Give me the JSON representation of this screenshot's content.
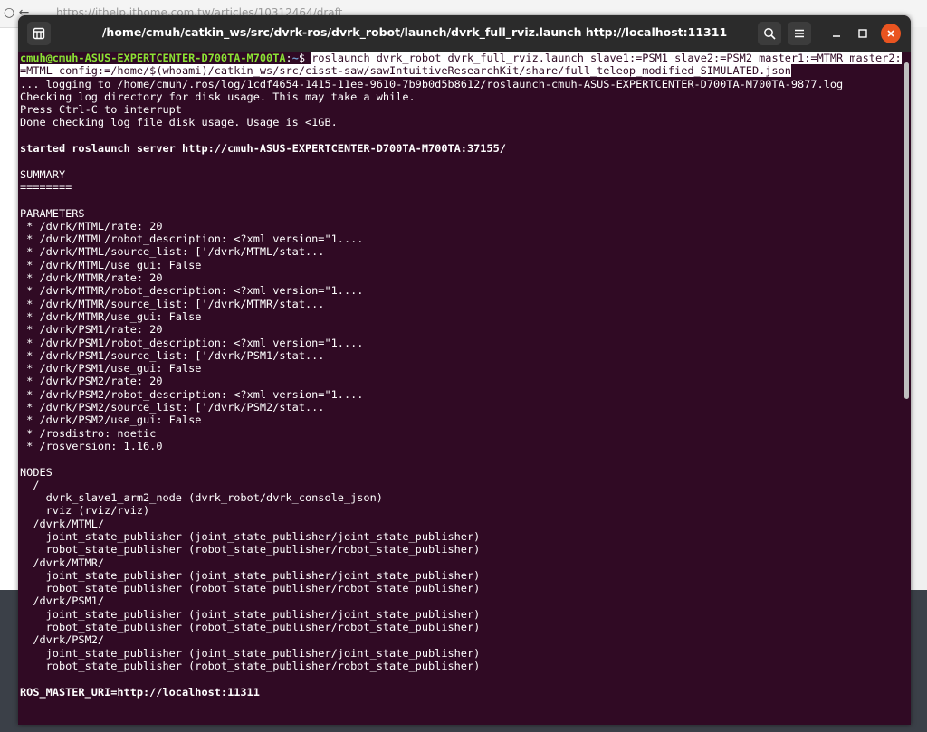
{
  "background": {
    "url_text": "https://ithelp.ithome.com.tw/articles/10312464/draft"
  },
  "window": {
    "title": "/home/cmuh/catkin_ws/src/dvrk-ros/dvrk_robot/launch/dvrk_full_rviz.launch http://localhost:11311",
    "accent_close": "#e95420",
    "bg_color": "#300a24"
  },
  "terminal": {
    "prompt": {
      "user_host": "cmuh@cmuh-ASUS-EXPERTCENTER-D700TA-M700TA",
      "sep": ":",
      "path": "~",
      "symbol": "$ "
    },
    "command_line1": "roslaunch dvrk_robot dvrk_full_rviz.launch slave1:=PSM1 slave2:=PSM2 master1:=MTMR master2:",
    "command_line2": "=MTML config:=/home/$(whoami)/catkin_ws/src/cisst-saw/sawIntuitiveResearchKit/share/full_teleop_modified_SIMULATED.json",
    "lines": [
      "... logging to /home/cmuh/.ros/log/1cdf4654-1415-11ee-9610-7b9b0d5b8612/roslaunch-cmuh-ASUS-EXPERTCENTER-D700TA-M700TA-9877.log",
      "Checking log directory for disk usage. This may take a while.",
      "Press Ctrl-C to interrupt",
      "Done checking log file disk usage. Usage is <1GB.",
      "",
      "started roslaunch server http://cmuh-ASUS-EXPERTCENTER-D700TA-M700TA:37155/",
      "",
      "SUMMARY",
      "========",
      "",
      "PARAMETERS",
      " * /dvrk/MTML/rate: 20",
      " * /dvrk/MTML/robot_description: <?xml version=\"1....",
      " * /dvrk/MTML/source_list: ['/dvrk/MTML/stat...",
      " * /dvrk/MTML/use_gui: False",
      " * /dvrk/MTMR/rate: 20",
      " * /dvrk/MTMR/robot_description: <?xml version=\"1....",
      " * /dvrk/MTMR/source_list: ['/dvrk/MTMR/stat...",
      " * /dvrk/MTMR/use_gui: False",
      " * /dvrk/PSM1/rate: 20",
      " * /dvrk/PSM1/robot_description: <?xml version=\"1....",
      " * /dvrk/PSM1/source_list: ['/dvrk/PSM1/stat...",
      " * /dvrk/PSM1/use_gui: False",
      " * /dvrk/PSM2/rate: 20",
      " * /dvrk/PSM2/robot_description: <?xml version=\"1....",
      " * /dvrk/PSM2/source_list: ['/dvrk/PSM2/stat...",
      " * /dvrk/PSM2/use_gui: False",
      " * /rosdistro: noetic",
      " * /rosversion: 1.16.0",
      "",
      "NODES",
      "  /",
      "    dvrk_slave1_arm2_node (dvrk_robot/dvrk_console_json)",
      "    rviz (rviz/rviz)",
      "  /dvrk/MTML/",
      "    joint_state_publisher (joint_state_publisher/joint_state_publisher)",
      "    robot_state_publisher (robot_state_publisher/robot_state_publisher)",
      "  /dvrk/MTMR/",
      "    joint_state_publisher (joint_state_publisher/joint_state_publisher)",
      "    robot_state_publisher (robot_state_publisher/robot_state_publisher)",
      "  /dvrk/PSM1/",
      "    joint_state_publisher (joint_state_publisher/joint_state_publisher)",
      "    robot_state_publisher (robot_state_publisher/robot_state_publisher)",
      "  /dvrk/PSM2/",
      "    joint_state_publisher (joint_state_publisher/joint_state_publisher)",
      "    robot_state_publisher (robot_state_publisher/robot_state_publisher)",
      "",
      "ROS_MASTER_URI=http://localhost:11311"
    ],
    "bold_lines": [
      5,
      47
    ]
  }
}
